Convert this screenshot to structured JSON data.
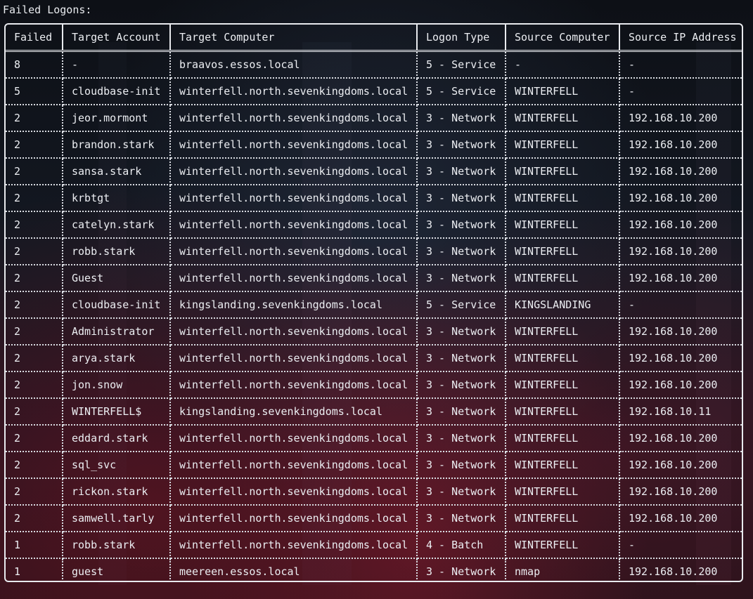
{
  "title": "Failed Logons:",
  "columns": [
    "Failed",
    "Target Account",
    "Target Computer",
    "Logon Type",
    "Source Computer",
    "Source IP Address"
  ],
  "rows": [
    [
      "8",
      "-",
      "braavos.essos.local",
      "5 - Service",
      "-",
      "-"
    ],
    [
      "5",
      "cloudbase-init",
      "winterfell.north.sevenkingdoms.local",
      "5 - Service",
      "WINTERFELL",
      "-"
    ],
    [
      "2",
      "jeor.mormont",
      "winterfell.north.sevenkingdoms.local",
      "3 - Network",
      "WINTERFELL",
      "192.168.10.200"
    ],
    [
      "2",
      "brandon.stark",
      "winterfell.north.sevenkingdoms.local",
      "3 - Network",
      "WINTERFELL",
      "192.168.10.200"
    ],
    [
      "2",
      "sansa.stark",
      "winterfell.north.sevenkingdoms.local",
      "3 - Network",
      "WINTERFELL",
      "192.168.10.200"
    ],
    [
      "2",
      "krbtgt",
      "winterfell.north.sevenkingdoms.local",
      "3 - Network",
      "WINTERFELL",
      "192.168.10.200"
    ],
    [
      "2",
      "catelyn.stark",
      "winterfell.north.sevenkingdoms.local",
      "3 - Network",
      "WINTERFELL",
      "192.168.10.200"
    ],
    [
      "2",
      "robb.stark",
      "winterfell.north.sevenkingdoms.local",
      "3 - Network",
      "WINTERFELL",
      "192.168.10.200"
    ],
    [
      "2",
      "Guest",
      "winterfell.north.sevenkingdoms.local",
      "3 - Network",
      "WINTERFELL",
      "192.168.10.200"
    ],
    [
      "2",
      "cloudbase-init",
      "kingslanding.sevenkingdoms.local",
      "5 - Service",
      "KINGSLANDING",
      "-"
    ],
    [
      "2",
      "Administrator",
      "winterfell.north.sevenkingdoms.local",
      "3 - Network",
      "WINTERFELL",
      "192.168.10.200"
    ],
    [
      "2",
      "arya.stark",
      "winterfell.north.sevenkingdoms.local",
      "3 - Network",
      "WINTERFELL",
      "192.168.10.200"
    ],
    [
      "2",
      "jon.snow",
      "winterfell.north.sevenkingdoms.local",
      "3 - Network",
      "WINTERFELL",
      "192.168.10.200"
    ],
    [
      "2",
      "WINTERFELL$",
      "kingslanding.sevenkingdoms.local",
      "3 - Network",
      "WINTERFELL",
      "192.168.10.11"
    ],
    [
      "2",
      "eddard.stark",
      "winterfell.north.sevenkingdoms.local",
      "3 - Network",
      "WINTERFELL",
      "192.168.10.200"
    ],
    [
      "2",
      "sql_svc",
      "winterfell.north.sevenkingdoms.local",
      "3 - Network",
      "WINTERFELL",
      "192.168.10.200"
    ],
    [
      "2",
      "rickon.stark",
      "winterfell.north.sevenkingdoms.local",
      "3 - Network",
      "WINTERFELL",
      "192.168.10.200"
    ],
    [
      "2",
      "samwell.tarly",
      "winterfell.north.sevenkingdoms.local",
      "3 - Network",
      "WINTERFELL",
      "192.168.10.200"
    ],
    [
      "1",
      "robb.stark",
      "winterfell.north.sevenkingdoms.local",
      "4 - Batch",
      "WINTERFELL",
      "-"
    ],
    [
      "1",
      "guest",
      "meereen.essos.local",
      "3 - Network",
      "nmap",
      "192.168.10.200"
    ]
  ]
}
